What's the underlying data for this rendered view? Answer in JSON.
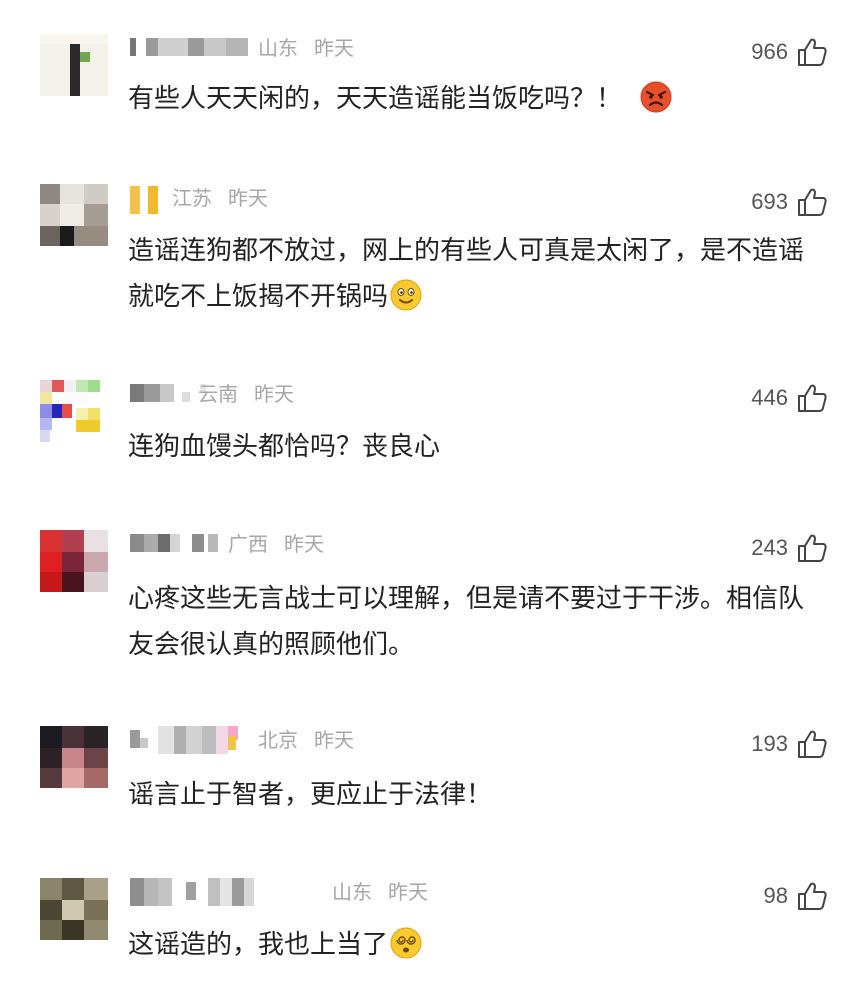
{
  "comments": [
    {
      "region": "山东",
      "time": "昨天",
      "likes": "966",
      "text": "有些人天天闲的，天天造谣能当饭吃吗？！",
      "emoji": "angry-face-icon"
    },
    {
      "region": "江苏",
      "time": "昨天",
      "likes": "693",
      "text": "造谣连狗都不放过，网上的有些人可真是太闲了，是不造谣就吃不上饭揭不开锅吗",
      "emoji": "smiling-face-icon"
    },
    {
      "region": "云南",
      "time": "昨天",
      "likes": "446",
      "text": "连狗血馒头都恰吗？丧良心",
      "emoji": ""
    },
    {
      "region": "广西",
      "time": "昨天",
      "likes": "243",
      "text": "心疼这些无言战士可以理解，但是请不要过于干涉。相信队友会很认真的照顾他们。",
      "emoji": ""
    },
    {
      "region": "北京",
      "time": "昨天",
      "likes": "193",
      "text": "谣言止于智者，更应止于法律！",
      "emoji": ""
    },
    {
      "region": "山东",
      "time": "昨天",
      "likes": "98",
      "text": "这谣造的，我也上当了",
      "emoji": "dizzy-face-icon"
    }
  ],
  "colors": {
    "meta": "#a6a6a6",
    "text": "#222222",
    "likes": "#555555"
  }
}
